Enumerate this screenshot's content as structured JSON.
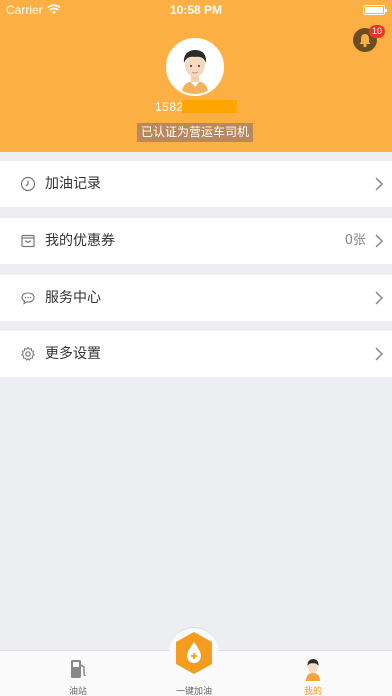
{
  "status_bar": {
    "carrier": "Carrier",
    "time": "10:58 PM",
    "wifi_icon": "wifi-icon",
    "battery_icon": "battery-icon"
  },
  "header": {
    "background_color": "#fcb043",
    "notification_count": "10",
    "notification_icon": "bell-icon",
    "phone_visible": "1582",
    "verified_text": "已认证为营运车司机"
  },
  "menu": [
    {
      "label": "加油记录",
      "icon": "clock-icon",
      "value": ""
    },
    {
      "label": "我的优惠券",
      "icon": "coupon-icon",
      "value": "0张"
    },
    {
      "label": "服务中心",
      "icon": "chat-icon",
      "value": ""
    },
    {
      "label": "更多设置",
      "icon": "gear-icon",
      "value": ""
    }
  ],
  "tabbar": {
    "tabs": [
      {
        "label": "油站",
        "icon": "fuel-pump-icon",
        "active": false
      },
      {
        "label": "一键加油",
        "icon": "fuel-drop-icon",
        "active": false
      },
      {
        "label": "我的",
        "icon": "profile-icon",
        "active": true
      }
    ],
    "active_color": "#f39c12"
  }
}
